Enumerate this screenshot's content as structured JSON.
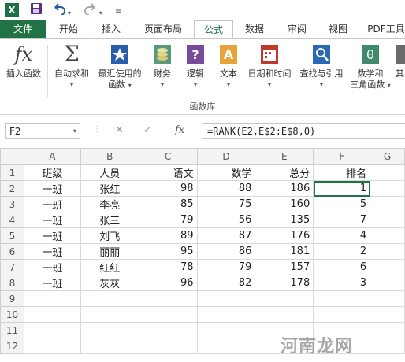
{
  "qat": {
    "excel_icon": "X",
    "save_icon": "save-icon",
    "undo_icon": "undo-icon",
    "redo_icon": "redo-icon"
  },
  "tabs": [
    {
      "label": "文件"
    },
    {
      "label": "开始"
    },
    {
      "label": "插入"
    },
    {
      "label": "页面布局"
    },
    {
      "label": "公式"
    },
    {
      "label": "数据"
    },
    {
      "label": "审阅"
    },
    {
      "label": "视图"
    },
    {
      "label": "PDF工具"
    }
  ],
  "ribbon": {
    "insert_function": "插入函数",
    "autosum": "自动求和",
    "recent_1": "最近使用的",
    "recent_2": "函数",
    "financial": "财务",
    "logical": "逻辑",
    "text": "文本",
    "datetime": "日期和时间",
    "lookup": "查找与引用",
    "math_1": "数学和",
    "math_2": "三角函数",
    "more": "其",
    "group": "函数库"
  },
  "formula_bar": {
    "name_box": "F2",
    "cancel": "✕",
    "enter": "✓",
    "fx": "fx",
    "formula": "=RANK(E2,E$2:E$8,0)"
  },
  "sheet": {
    "columns": [
      "A",
      "B",
      "C",
      "D",
      "E",
      "F",
      "G"
    ],
    "rows": [
      [
        "班级",
        "人员",
        "语文",
        "数学",
        "总分",
        "排名",
        ""
      ],
      [
        "一班",
        "张红",
        "98",
        "88",
        "186",
        "1",
        ""
      ],
      [
        "一班",
        "李亮",
        "85",
        "75",
        "160",
        "5",
        ""
      ],
      [
        "一班",
        "张三",
        "79",
        "56",
        "135",
        "7",
        ""
      ],
      [
        "一班",
        "刘飞",
        "89",
        "87",
        "176",
        "4",
        ""
      ],
      [
        "一班",
        "丽丽",
        "95",
        "86",
        "181",
        "2",
        ""
      ],
      [
        "一班",
        "红红",
        "78",
        "79",
        "157",
        "6",
        ""
      ],
      [
        "一班",
        "灰灰",
        "96",
        "82",
        "178",
        "3",
        ""
      ],
      [
        "",
        "",
        "",
        "",
        "",
        "",
        ""
      ],
      [
        "",
        "",
        "",
        "",
        "",
        "",
        ""
      ],
      [
        "",
        "",
        "",
        "",
        "",
        "",
        ""
      ],
      [
        "",
        "",
        "",
        "",
        "",
        "",
        ""
      ]
    ],
    "row_numbers": [
      "1",
      "2",
      "3",
      "4",
      "5",
      "6",
      "7",
      "8",
      "9",
      "10",
      "11",
      "12"
    ]
  },
  "watermark": "河南龙网",
  "colors": {
    "excel_green": "#217346",
    "header_gray": "#f3f3f3"
  }
}
